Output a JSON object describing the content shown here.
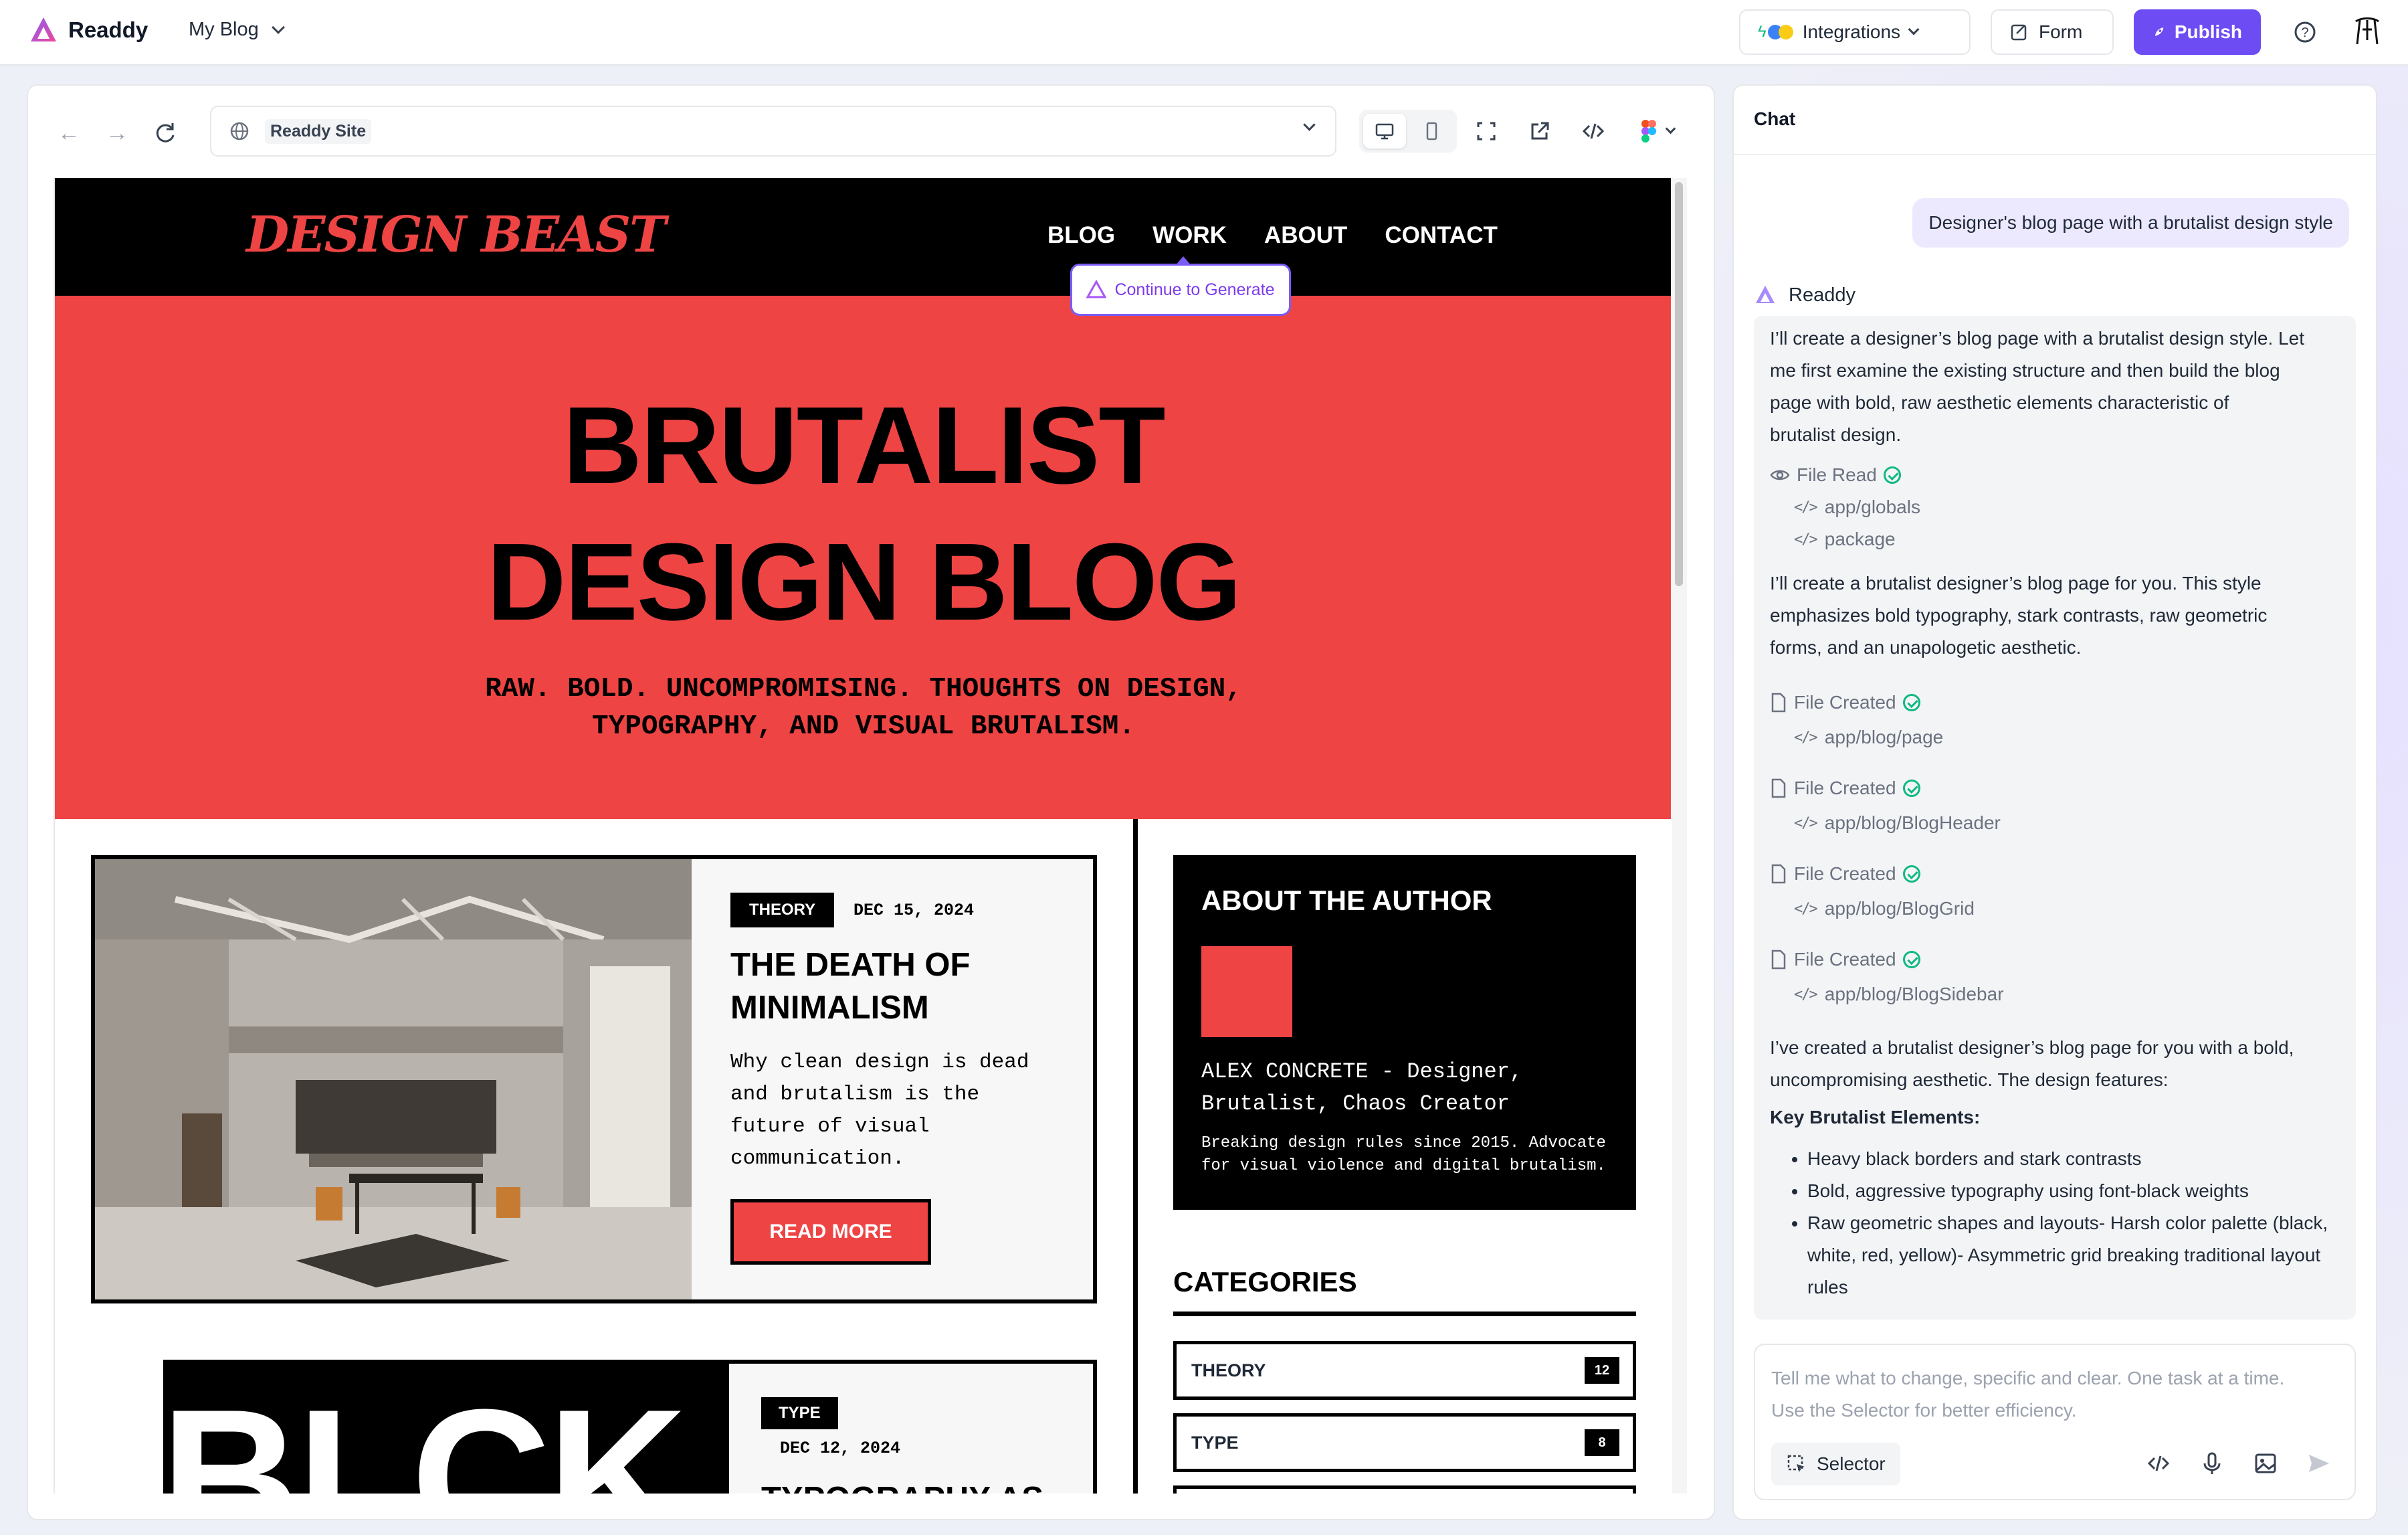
{
  "app": {
    "name": "Readdy",
    "project": "My Blog"
  },
  "topbar": {
    "integrations_label": "Integrations",
    "form_label": "Form",
    "publish_label": "Publish"
  },
  "browser": {
    "url_label": "Readdy Site"
  },
  "site": {
    "logo": "DESIGN BEAST",
    "nav": [
      "BLOG",
      "WORK",
      "ABOUT",
      "CONTACT"
    ],
    "generate_label": "Continue to Generate",
    "hero": {
      "line1": "BRUTALIST",
      "line2": "DESIGN BLOG",
      "sub1": "RAW. BOLD. UNCOMPROMISING. THOUGHTS ON DESIGN,",
      "sub2": "TYPOGRAPHY, AND VISUAL BRUTALISM."
    },
    "posts": [
      {
        "tag": "THEORY",
        "date": "DEC 15, 2024",
        "title1": "THE DEATH OF",
        "title2": "MINIMALISM",
        "excerpt": [
          "Why clean design is dead",
          "and brutalism is the",
          "future of visual",
          "communication."
        ],
        "cta": "READ MORE"
      },
      {
        "tag": "TYPE",
        "date": "DEC 12, 2024",
        "image_text": "BLCK",
        "title1": "TYPOGRAPHY AS"
      }
    ],
    "author": {
      "heading": "ABOUT THE AUTHOR",
      "name1": "ALEX CONCRETE - Designer,",
      "name2": "Brutalist, Chaos Creator",
      "bio1": "Breaking design rules since 2015. Advocate",
      "bio2": "for visual violence and digital brutalism."
    },
    "categories": {
      "heading": "CATEGORIES",
      "items": [
        {
          "name": "THEORY",
          "count": "12"
        },
        {
          "name": "TYPE",
          "count": "8"
        }
      ]
    }
  },
  "chat": {
    "title": "Chat",
    "user_message": "Designer's blog page with a brutalist design style",
    "bot_name": "Readdy",
    "intro": [
      "I’ll create a designer’s blog page with a brutalist design style. Let",
      "me first examine the existing structure and then build the blog",
      "page with bold, raw aesthetic elements characteristic of",
      "brutalist design."
    ],
    "file_read_label": "File Read",
    "files_read": [
      "app/globals",
      "package"
    ],
    "middle": [
      "I’ll create a brutalist designer’s blog page for you. This style",
      "emphasizes bold typography, stark contrasts, raw geometric",
      "forms, and an unapologetic aesthetic."
    ],
    "file_created_label": "File Created",
    "files_created": [
      "app/blog/page",
      "app/blog/BlogHeader",
      "app/blog/BlogGrid",
      "app/blog/BlogSidebar"
    ],
    "summary": [
      "I’ve created a brutalist designer’s blog page for you with a bold,",
      "uncompromising aesthetic. The design features:"
    ],
    "elements_heading": "Key Brutalist Elements:",
    "bullets": [
      "Heavy black borders and stark contrasts",
      "Bold, aggressive typography using font-black weights",
      "Raw geometric shapes and layouts- Harsh color palette (black, white, red, yellow)- Asymmetric grid breaking traditional layout rules"
    ],
    "composer_placeholder": [
      "Tell me what to change, specific and clear. One task at a time.",
      "Use the Selector for better efficiency."
    ],
    "selector_label": "Selector"
  },
  "colors": {
    "accent": "#ef4444",
    "brand": "#6d4cf3",
    "black": "#000000"
  }
}
